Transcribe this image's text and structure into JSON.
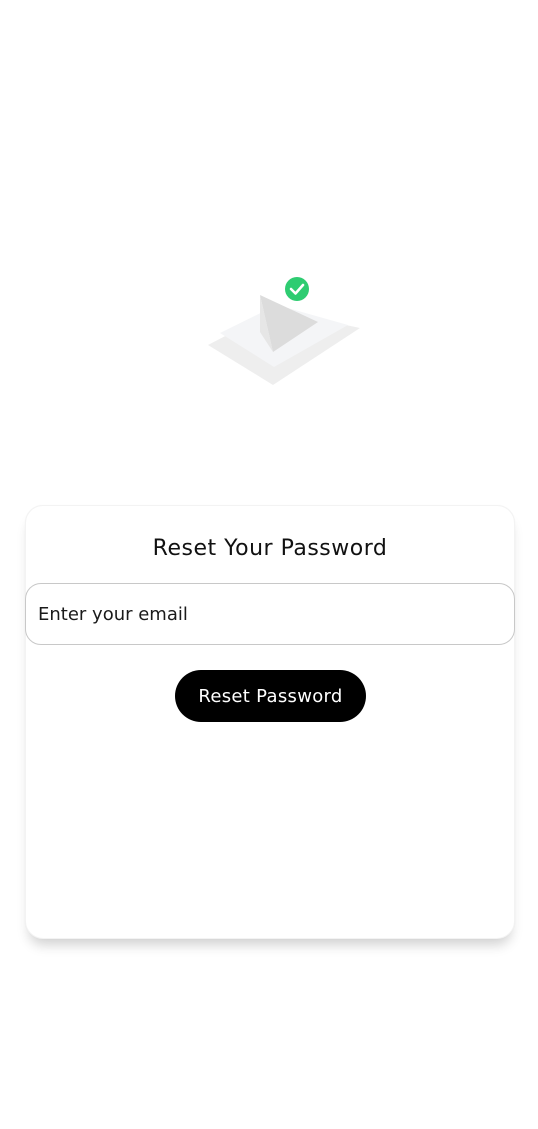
{
  "illustration": {
    "icon": "email-sent-check-icon",
    "check_color": "#2ecc71"
  },
  "card": {
    "title": "Reset Your Password",
    "email_input": {
      "placeholder": "Enter your email",
      "value": ""
    },
    "reset_button": {
      "label": "Reset Password",
      "color": "#000000"
    }
  }
}
